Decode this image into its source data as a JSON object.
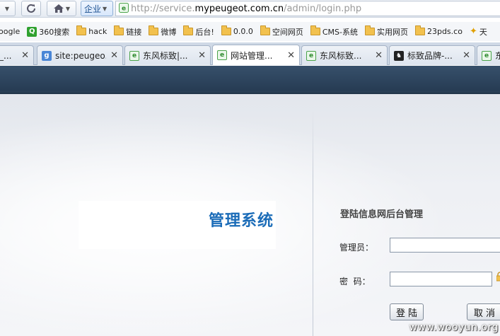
{
  "browser": {
    "enterprise_label": "企业",
    "address": {
      "url_prefix": "http://service.",
      "url_domain": "mypeugeot.com.cn",
      "url_path": "/admin/login.php"
    },
    "bookmarks": [
      {
        "label": "oogle",
        "icon": "google-icon"
      },
      {
        "label": "360搜索",
        "icon": "360-search-icon"
      },
      {
        "label": "hack",
        "icon": "folder-icon"
      },
      {
        "label": "链接",
        "icon": "folder-icon"
      },
      {
        "label": "微博",
        "icon": "folder-icon"
      },
      {
        "label": "后台!",
        "icon": "folder-icon"
      },
      {
        "label": "0.0.0",
        "icon": "folder-icon"
      },
      {
        "label": "空间网页",
        "icon": "folder-icon"
      },
      {
        "label": "CMS-系统",
        "icon": "folder-icon"
      },
      {
        "label": "实用网页",
        "icon": "folder-icon"
      },
      {
        "label": "23pds.co",
        "icon": "folder-icon"
      },
      {
        "label": "天",
        "icon": "star-icon"
      }
    ],
    "tabs": [
      {
        "label": "_...",
        "icon": "none"
      },
      {
        "label": "site:peugeo...",
        "icon": "google-icon"
      },
      {
        "label": "东风标致|...",
        "icon": "ie-page-icon"
      },
      {
        "label": "网站管理...",
        "icon": "ie-page-icon",
        "active": true
      },
      {
        "label": "东风标致...",
        "icon": "ie-page-icon"
      },
      {
        "label": "标致品牌-...",
        "icon": "peugeot-icon"
      },
      {
        "label": "东",
        "icon": "ie-page-icon"
      }
    ],
    "close_glyph": "✕"
  },
  "login": {
    "system_title": "管理系统",
    "form_title": "登陆信息网后台管理",
    "username_label": "管理员：",
    "password_label": "密  码：",
    "username_value": "",
    "password_value": "",
    "login_button": "登陆",
    "cancel_button": "取消"
  },
  "watermark": "www.wooyun.org",
  "colors": {
    "banner": "#2b4259",
    "system_title": "#1b6cb8"
  }
}
